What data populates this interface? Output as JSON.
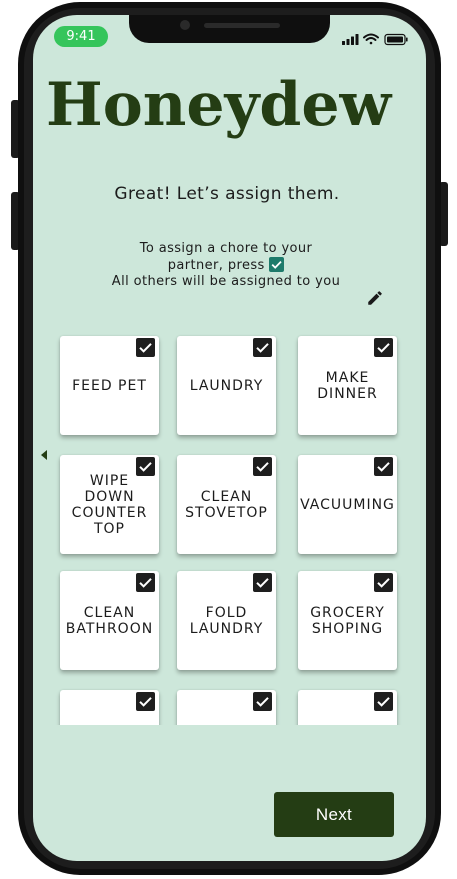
{
  "status_bar": {
    "time": "9:41"
  },
  "app": {
    "title": "Honeydew"
  },
  "heading": "Great! Let’s assign them.",
  "instructions": {
    "line1": "To assign a chore to your partner, press",
    "line2": "All others will be assigned to you"
  },
  "chores": [
    {
      "label": "FEED PET",
      "checked": true
    },
    {
      "label": "LAUNDRY",
      "checked": true
    },
    {
      "label": "MAKE\nDINNER",
      "checked": true
    },
    {
      "label": "WIPE DOWN\nCOUNTER\nTOP",
      "checked": true
    },
    {
      "label": "CLEAN\nSTOVETOP",
      "checked": true
    },
    {
      "label": "VACUUMING",
      "checked": true
    },
    {
      "label": "CLEAN\nBATHROON",
      "checked": true
    },
    {
      "label": "FOLD\nLAUNDRY",
      "checked": true
    },
    {
      "label": "GROCERY\nSHOPING",
      "checked": true
    },
    {
      "label": "",
      "checked": true
    },
    {
      "label": "",
      "checked": true
    },
    {
      "label": "",
      "checked": true
    }
  ],
  "next_button": {
    "label": "Next"
  },
  "colors": {
    "background": "#cde7da",
    "brand": "#243d14",
    "check_accent": "#1e7b6b",
    "time_pill": "#35c55b"
  },
  "icons": {
    "edit": "pencil-icon",
    "back": "left-arrow-icon",
    "check": "checkbox-checked-icon"
  }
}
